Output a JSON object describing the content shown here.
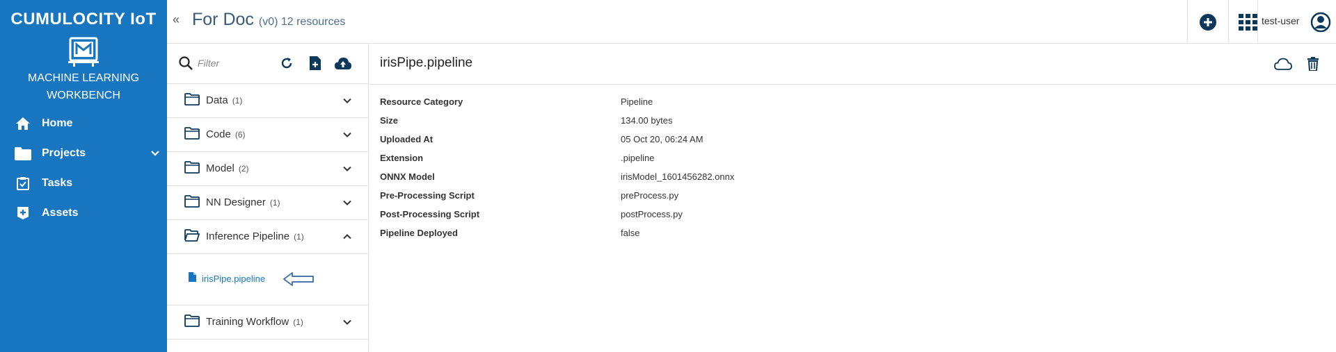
{
  "sidebar": {
    "brand": "CUMULOCITY IoT",
    "app_name": "MACHINE LEARNING WORKBENCH",
    "items": [
      {
        "label": "Home",
        "icon": "home-icon"
      },
      {
        "label": "Projects",
        "icon": "folder-icon"
      },
      {
        "label": "Tasks",
        "icon": "clipboard-check-icon"
      },
      {
        "label": "Assets",
        "icon": "asset-plus-icon"
      }
    ]
  },
  "header": {
    "collapse": "«",
    "title": "For Doc",
    "subtitle": "(v0) 12 resources",
    "user": "test-user"
  },
  "toolbar": {
    "filter_placeholder": "Filter"
  },
  "folders": [
    {
      "label": "Data",
      "count": "(1)",
      "expanded": false
    },
    {
      "label": "Code",
      "count": "(6)",
      "expanded": false
    },
    {
      "label": "Model",
      "count": "(2)",
      "expanded": false
    },
    {
      "label": "NN Designer",
      "count": "(1)",
      "expanded": false
    },
    {
      "label": "Inference Pipeline",
      "count": "(1)",
      "expanded": true
    },
    {
      "label": "Training Workflow",
      "count": "(1)",
      "expanded": false
    }
  ],
  "selected_file": "irisPipe.pipeline",
  "detail": {
    "title": "irisPipe.pipeline",
    "properties": [
      {
        "key": "Resource Category",
        "value": "Pipeline"
      },
      {
        "key": "Size",
        "value": "134.00 bytes"
      },
      {
        "key": "Uploaded At",
        "value": "05 Oct 20, 06:24 AM"
      },
      {
        "key": "Extension",
        "value": ".pipeline"
      },
      {
        "key": "ONNX Model",
        "value": "irisModel_1601456282.onnx"
      },
      {
        "key": "Pre-Processing Script",
        "value": "preProcess.py"
      },
      {
        "key": "Post-Processing Script",
        "value": "postProcess.py"
      },
      {
        "key": "Pipeline Deployed",
        "value": "false"
      }
    ]
  },
  "colors": {
    "sidebar_bg": "#1776bf",
    "accent": "#1776bf",
    "icon_dark": "#0b385b"
  }
}
